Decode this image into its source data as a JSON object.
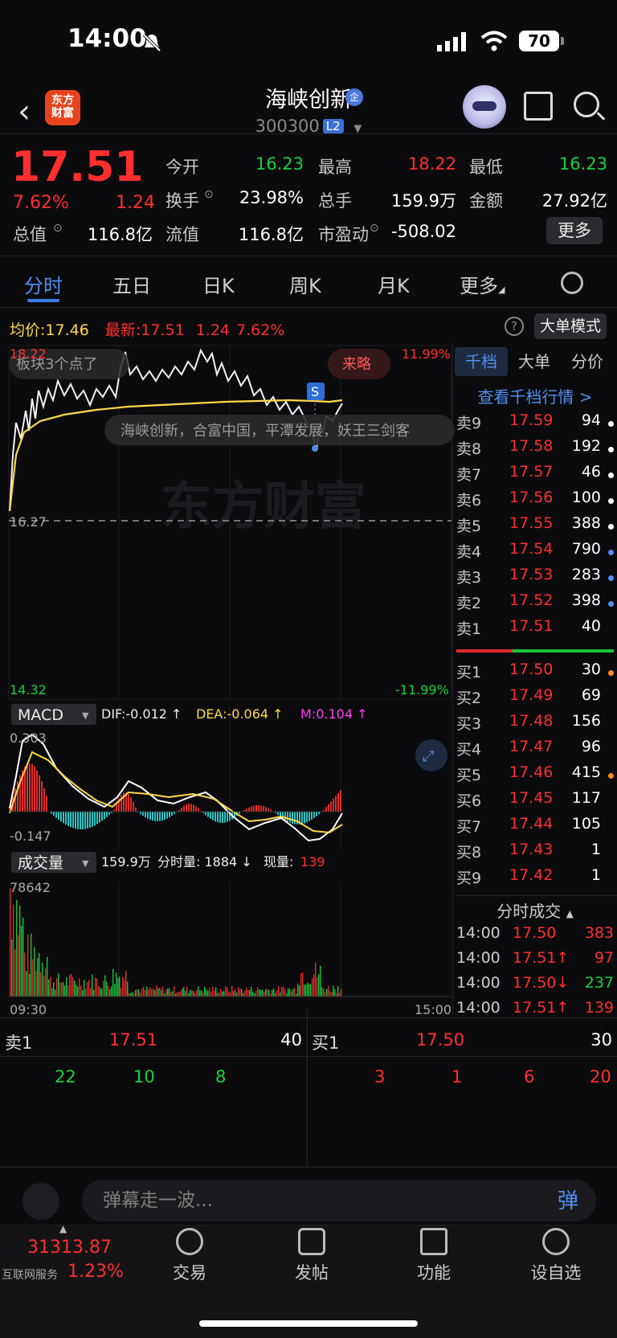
{
  "status_bar": {
    "time": "14:00",
    "battery": "70"
  },
  "header": {
    "stock_name": "海峡创新",
    "qi_badge": "企",
    "code": "300300",
    "level": "L2",
    "brand": "东方\n财富"
  },
  "quote": {
    "price": "17.51",
    "change_pct": "7.62%",
    "change_abs": "1.24",
    "fields": [
      {
        "label": "今开",
        "value": "16.23",
        "color": "#19d13d"
      },
      {
        "label": "最高",
        "value": "18.22",
        "color": "#ff2f2f"
      },
      {
        "label": "最低",
        "value": "16.23",
        "color": "#19d13d"
      },
      {
        "label": "换手",
        "value": "23.98%",
        "color": "#ffffff"
      },
      {
        "label": "总手",
        "value": "159.9万",
        "color": "#ffffff"
      },
      {
        "label": "金额",
        "value": "27.92亿",
        "color": "#ffffff"
      },
      {
        "label": "总值",
        "value": "116.8亿",
        "color": "#ffffff"
      },
      {
        "label": "流值",
        "value": "116.8亿",
        "color": "#ffffff"
      },
      {
        "label": "市盈动",
        "value": "-508.02",
        "color": "#ffffff"
      }
    ],
    "more_button": "更多"
  },
  "tabs": [
    "分时",
    "五日",
    "日K",
    "周K",
    "月K",
    "更多"
  ],
  "avg_row": {
    "avg_label": "均价:",
    "avg_value": "17.46",
    "latest_label": "最新:",
    "latest_value": "17.51",
    "change": "1.24",
    "pct": "7.62%"
  },
  "big_order_mode": "大单模式",
  "chart": {
    "price_high": "18.22",
    "price_low": "14.32",
    "pct_high": "11.99%",
    "pct_low": "-11.99%",
    "prev_close": "16.27",
    "watermark": "东方财富",
    "bubble_sector": "板块3个点了",
    "bubble_strategy": "来略",
    "marker_s": "S",
    "ticker_text": "海峡创新，合富中国，平潭发展，妖王三剑客",
    "macd_label": "MACD",
    "dif": "DIF:-0.012 ↑",
    "dea": "DEA:-0.064 ↑",
    "m": "M:0.104 ↑",
    "macd_top": "0.303",
    "macd_bottom": "-0.147",
    "vol_label": "成交量",
    "vol_total": "159.9万",
    "vol_tick": "分时量: 1884 ↓",
    "vol_now_label": "现量:",
    "vol_now": "139",
    "vol_max": "78642",
    "time_start": "09:30",
    "time_end": "15:00"
  },
  "order_book": {
    "tabs": [
      "千档",
      "大单",
      "分价"
    ],
    "view_link": "查看千档行情 >",
    "asks": [
      {
        "label": "卖9",
        "price": "17.59",
        "vol": "94",
        "dot": "#ffffff"
      },
      {
        "label": "卖8",
        "price": "17.58",
        "vol": "192",
        "dot": "#ffffff"
      },
      {
        "label": "卖7",
        "price": "17.57",
        "vol": "46",
        "dot": "#ffffff"
      },
      {
        "label": "卖6",
        "price": "17.56",
        "vol": "100",
        "dot": "#ffffff"
      },
      {
        "label": "卖5",
        "price": "17.55",
        "vol": "388",
        "dot": "#ffffff"
      },
      {
        "label": "卖4",
        "price": "17.54",
        "vol": "790",
        "dot": "#4f8ff0"
      },
      {
        "label": "卖3",
        "price": "17.53",
        "vol": "283",
        "dot": "#4f8ff0"
      },
      {
        "label": "卖2",
        "price": "17.52",
        "vol": "398",
        "dot": "#4f8ff0"
      },
      {
        "label": "卖1",
        "price": "17.51",
        "vol": "40",
        "dot": ""
      }
    ],
    "bids": [
      {
        "label": "买1",
        "price": "17.50",
        "vol": "30",
        "dot": "#ff8a1e"
      },
      {
        "label": "买2",
        "price": "17.49",
        "vol": "69",
        "dot": ""
      },
      {
        "label": "买3",
        "price": "17.48",
        "vol": "156",
        "dot": ""
      },
      {
        "label": "买4",
        "price": "17.47",
        "vol": "96",
        "dot": ""
      },
      {
        "label": "买5",
        "price": "17.46",
        "vol": "415",
        "dot": "#ff8a1e"
      },
      {
        "label": "买6",
        "price": "17.45",
        "vol": "117",
        "dot": ""
      },
      {
        "label": "买7",
        "price": "17.44",
        "vol": "105",
        "dot": ""
      },
      {
        "label": "买8",
        "price": "17.43",
        "vol": "1",
        "dot": ""
      },
      {
        "label": "买9",
        "price": "17.42",
        "vol": "1",
        "dot": ""
      }
    ],
    "tick_title": "分时成交",
    "ticks": [
      {
        "time": "14:00",
        "price": "17.50",
        "vol": "383",
        "vcolor": "#ff2f2f"
      },
      {
        "time": "14:00",
        "price": "17.51↑",
        "vol": "97",
        "vcolor": "#ff2f2f"
      },
      {
        "time": "14:00",
        "price": "17.50↓",
        "vol": "237",
        "vcolor": "#19d13d"
      },
      {
        "time": "14:00",
        "price": "17.51↑",
        "vol": "139",
        "vcolor": "#ff2f2f"
      }
    ]
  },
  "quick_book": {
    "ask_label": "卖1",
    "ask_price": "17.51",
    "ask_vol": "40",
    "bid_label": "买1",
    "bid_price": "17.50",
    "bid_vol": "30",
    "ask_queue": [
      "22",
      "10",
      "8"
    ],
    "bid_queue": [
      "3",
      "1",
      "6",
      "20"
    ]
  },
  "barrage": {
    "placeholder": "弹幕走一波...",
    "send": "弹"
  },
  "tabbar": {
    "index_value": "31313.87",
    "index_name": "互联网服务",
    "index_pct": "1.23%",
    "items": [
      "交易",
      "发帖",
      "功能",
      "设自选"
    ]
  }
}
